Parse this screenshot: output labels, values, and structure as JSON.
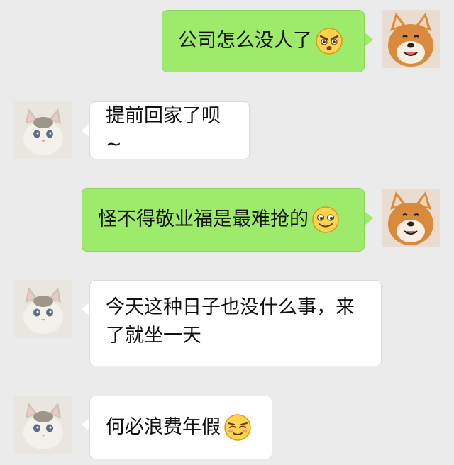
{
  "messages": [
    {
      "sender": "dog",
      "text": "公司怎么没人了",
      "emoji": "angry-face-icon"
    },
    {
      "sender": "cat",
      "text": "提前回家了呗~"
    },
    {
      "sender": "dog",
      "text": "怪不得敬业福是最难抢的",
      "emoji": "smiling-face-icon"
    },
    {
      "sender": "cat",
      "text": "今天这种日子也没什么事，来了就坐一天"
    },
    {
      "sender": "cat",
      "text": "何必浪费年假",
      "emoji": "smug-face-icon"
    }
  ],
  "colors": {
    "background": "#ebebeb",
    "sent_bubble": "#9eea6a",
    "received_bubble": "#ffffff"
  }
}
